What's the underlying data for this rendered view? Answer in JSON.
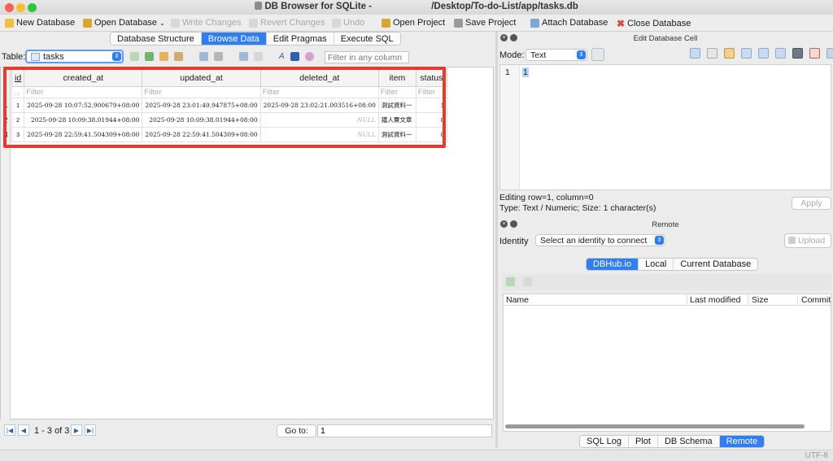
{
  "window": {
    "title": "DB Browser for SQLite - ",
    "path": "/Desktop/To-do-List/app/tasks.db"
  },
  "toolbar": {
    "new_db": "New Database",
    "open_db": "Open Database",
    "write": "Write Changes",
    "revert": "Revert Changes",
    "undo": "Undo",
    "open_project": "Open Project",
    "save_project": "Save Project",
    "attach": "Attach Database",
    "close_db": "Close Database"
  },
  "tabs": [
    "Database Structure",
    "Browse Data",
    "Edit Pragmas",
    "Execute SQL"
  ],
  "browse": {
    "table_label": "Table:",
    "table_value": "tasks",
    "filter_placeholder": "Filter in any column"
  },
  "grid": {
    "columns": [
      "id",
      "created_at",
      "updated_at",
      "deleted_at",
      "item",
      "status"
    ],
    "filter_first": "...",
    "filter": "Filter",
    "rows": [
      {
        "n": "1",
        "id": "1",
        "created_at": "2025-09-28 10:07:52.900679+08:00",
        "updated_at": "2025-09-28 23:01:49.947875+08:00",
        "deleted_at": "2025-09-28 23:02:21.003516+08:00",
        "item": "測試資料一",
        "status": "1"
      },
      {
        "n": "2",
        "id": "2",
        "created_at": "2025-09-28 10:09:38.01944+08:00",
        "updated_at": "2025-09-28 10:09:38.01944+08:00",
        "deleted_at": "NULL",
        "item": "鐵人賽文章",
        "status": "0"
      },
      {
        "n": "3",
        "id": "3",
        "created_at": "2025-09-28 22:59:41.504309+08:00",
        "updated_at": "2025-09-28 22:59:41.504309+08:00",
        "deleted_at": "NULL",
        "item": "測試資料一",
        "status": "0"
      }
    ]
  },
  "nav": {
    "range": "1 - 3 of 3",
    "goto_label": "Go to:",
    "goto_value": "1"
  },
  "edit_cell": {
    "title": "Edit Database Cell",
    "mode_label": "Mode:",
    "mode_value": "Text",
    "line_no": "1",
    "content": "1",
    "status1": "Editing row=1, column=0",
    "status2": "Type: Text / Numeric; Size: 1 character(s)",
    "apply": "Apply"
  },
  "remote": {
    "title": "Remote",
    "identity_label": "Identity",
    "identity_value": "Select an identity to connect",
    "upload": "Upload",
    "tabs": [
      "DBHub.io",
      "Local",
      "Current Database"
    ],
    "columns": [
      "Name",
      "Last modified",
      "Size",
      "Commit"
    ]
  },
  "bottom_tabs": [
    "SQL Log",
    "Plot",
    "DB Schema",
    "Remote"
  ],
  "status": {
    "encoding": "UTF-8"
  },
  "colors": {
    "accent": "#2f7ef6",
    "highlight": "#e83a2c"
  }
}
